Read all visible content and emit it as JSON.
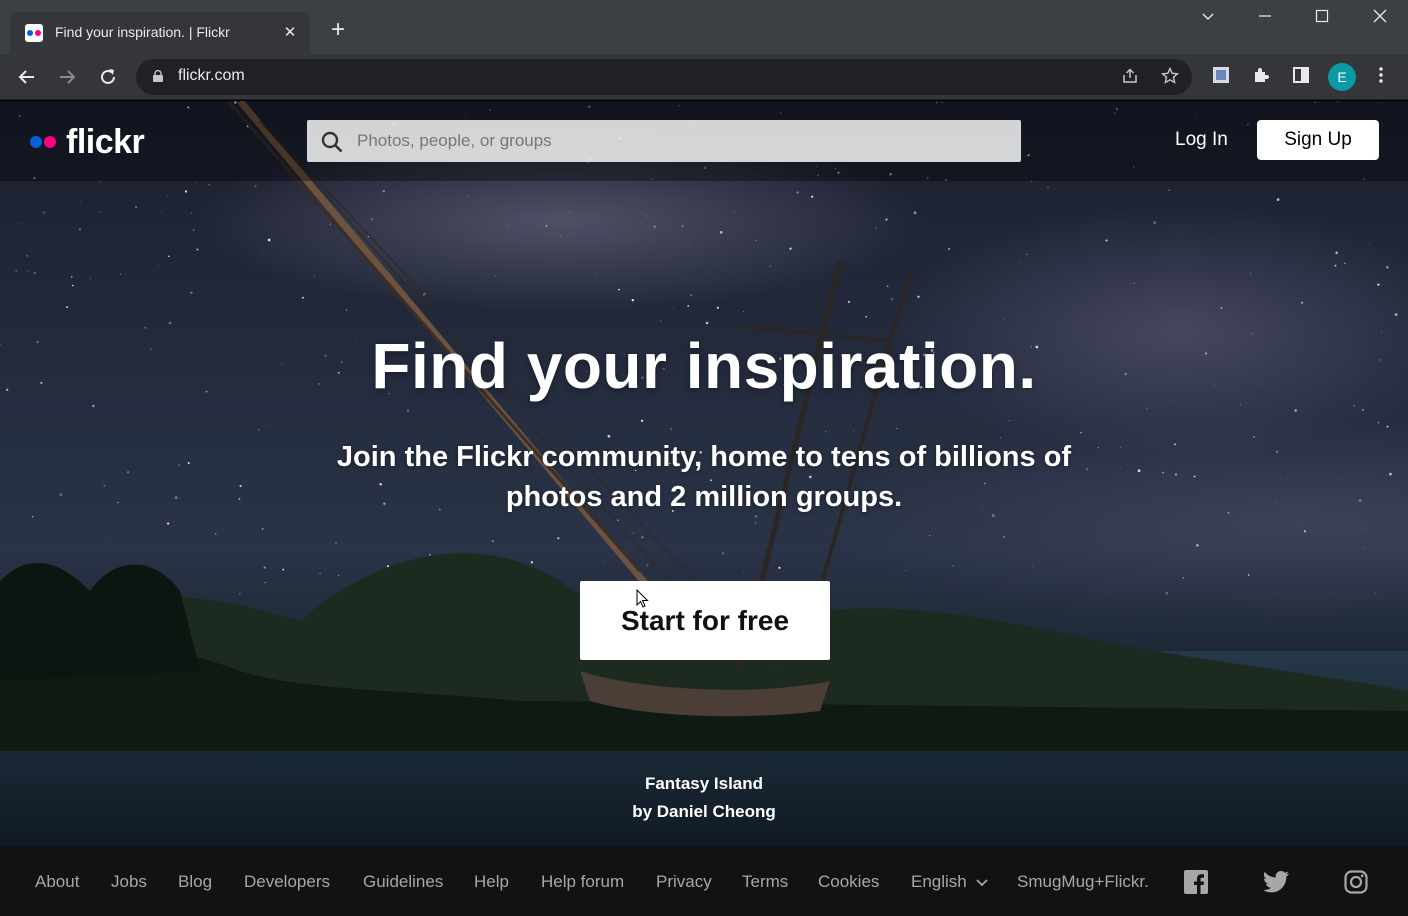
{
  "browser": {
    "tab_title": "Find your inspiration. | Flickr",
    "url": "flickr.com",
    "profile_initial": "E"
  },
  "header": {
    "logo_text": "flickr",
    "search_placeholder": "Photos, people, or groups",
    "login_label": "Log In",
    "signup_label": "Sign Up"
  },
  "hero": {
    "title": "Find your inspiration.",
    "subtitle": "Join the Flickr community, home to tens of billions of photos and 2 million groups.",
    "cta_label": "Start for free"
  },
  "photo_credit": {
    "title": "Fantasy Island",
    "author": "by Daniel Cheong"
  },
  "footer": {
    "links": [
      "About",
      "Jobs",
      "Blog",
      "Developers",
      "Guidelines",
      "Help",
      "Help forum",
      "Privacy",
      "Terms",
      "Cookies",
      "English",
      "SmugMug+Flickr."
    ],
    "social": [
      "facebook-icon",
      "twitter-icon",
      "instagram-icon"
    ]
  },
  "colors": {
    "flickr_blue": "#0063dc",
    "flickr_pink": "#ff0084",
    "chrome_tabbar": "#3c4043",
    "chrome_toolbar": "#35363a",
    "footer_bg": "#121212"
  }
}
